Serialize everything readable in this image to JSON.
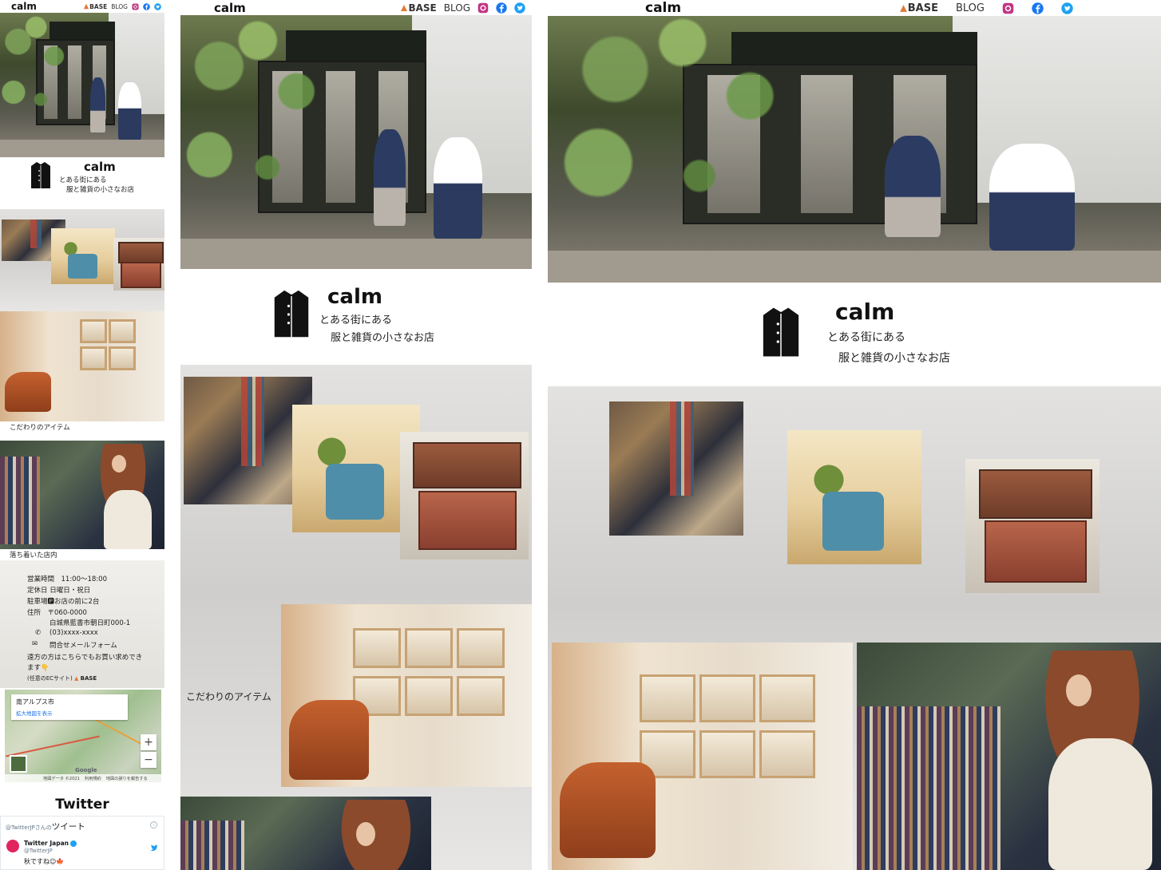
{
  "header": {
    "brand": "calm",
    "base_label": "BASE",
    "blog_label": "BLOG",
    "icons": [
      "base-shop-icon",
      "instagram-icon",
      "facebook-icon",
      "twitter-icon"
    ]
  },
  "intro": {
    "shop_name": "calm",
    "tagline_1": "とある街にある",
    "tagline_2": "服と雑貨の小さなお店",
    "icon": "coat-icon"
  },
  "sections": {
    "items_caption": "こだわりのアイテム",
    "store_caption": "落ち着いた店内"
  },
  "info": {
    "hours": "営業時間　11:00～18:00",
    "closed": "定休日 日曜日・祝日",
    "parking": "駐車場🅿お店の前に2台",
    "address_label": "住所　〒060-0000",
    "address": "白城県藍書市朝日町000-1",
    "phone": "(03)xxxx-xxxx",
    "contact": "問合せメールフォーム",
    "remote_1": "遠方の方はこちらでもお買い求めでき",
    "remote_2": "ます👇",
    "ec_label": "(任意のECサイト)",
    "ec_base": "BASE"
  },
  "map": {
    "city": "南アルプス市",
    "enlarge": "拡大地図を表示",
    "zoom_in": "+",
    "zoom_out": "−",
    "google": "Google",
    "attribution_1": "地図データ ©2021",
    "attribution_2": "利用規約",
    "attribution_3": "地図の誤りを報告する"
  },
  "twitter": {
    "heading": "Twitter",
    "handle_prefix": "@TwitterJPさんの",
    "tweets_label": "ツイート",
    "account_name": "Twitter Japan",
    "account_handle": "@TwitterJP",
    "tweet_text": "秋ですね☺🍁"
  },
  "colors": {
    "instagram": "#c13584",
    "facebook": "#1877f2",
    "twitter": "#1da1f2",
    "band": "#d8d7d5"
  }
}
